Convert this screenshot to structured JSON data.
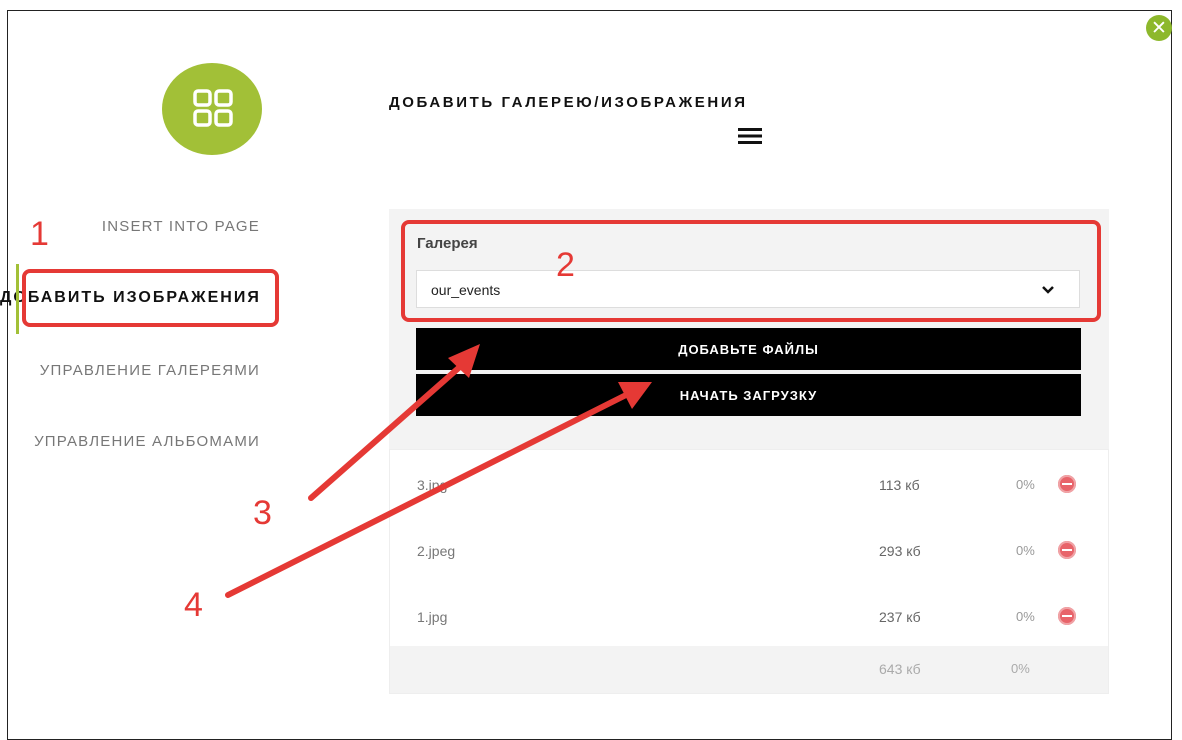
{
  "header": {
    "title": "ДОБАВИТЬ ГАЛЕРЕЮ/ИЗОБРАЖЕНИЯ"
  },
  "sidebar": {
    "items": [
      {
        "label": "INSERT INTO PAGE"
      },
      {
        "label": "ДОБАВИТЬ ИЗОБРАЖЕНИЯ"
      },
      {
        "label": "УПРАВЛЕНИЕ ГАЛЕРЕЯМИ"
      },
      {
        "label": "УПРАВЛЕНИЕ АЛЬБОМАМИ"
      }
    ]
  },
  "form": {
    "gallery_label": "Галерея",
    "gallery_selected": "our_events",
    "add_files_label": "ДОБАВЬТЕ ФАЙЛЫ",
    "start_upload_label": "НАЧАТЬ ЗАГРУЗКУ"
  },
  "files": [
    {
      "name": "3.jpg",
      "size": "113 кб",
      "progress": "0%"
    },
    {
      "name": "2.jpeg",
      "size": "293 кб",
      "progress": "0%"
    },
    {
      "name": "1.jpg",
      "size": "237 кб",
      "progress": "0%"
    }
  ],
  "totals": {
    "size": "643 кб",
    "progress": "0%"
  },
  "annotations": [
    "1",
    "2",
    "3",
    "4"
  ],
  "colors": {
    "accent": "#a2c037",
    "annotation": "#e53935",
    "button": "#000000",
    "delete": "#e8646a"
  },
  "icons": {
    "close": "close-icon",
    "logo": "gallery-grid-icon",
    "menu": "hamburger-icon",
    "select": "chevron-down-icon",
    "remove": "remove-icon"
  }
}
